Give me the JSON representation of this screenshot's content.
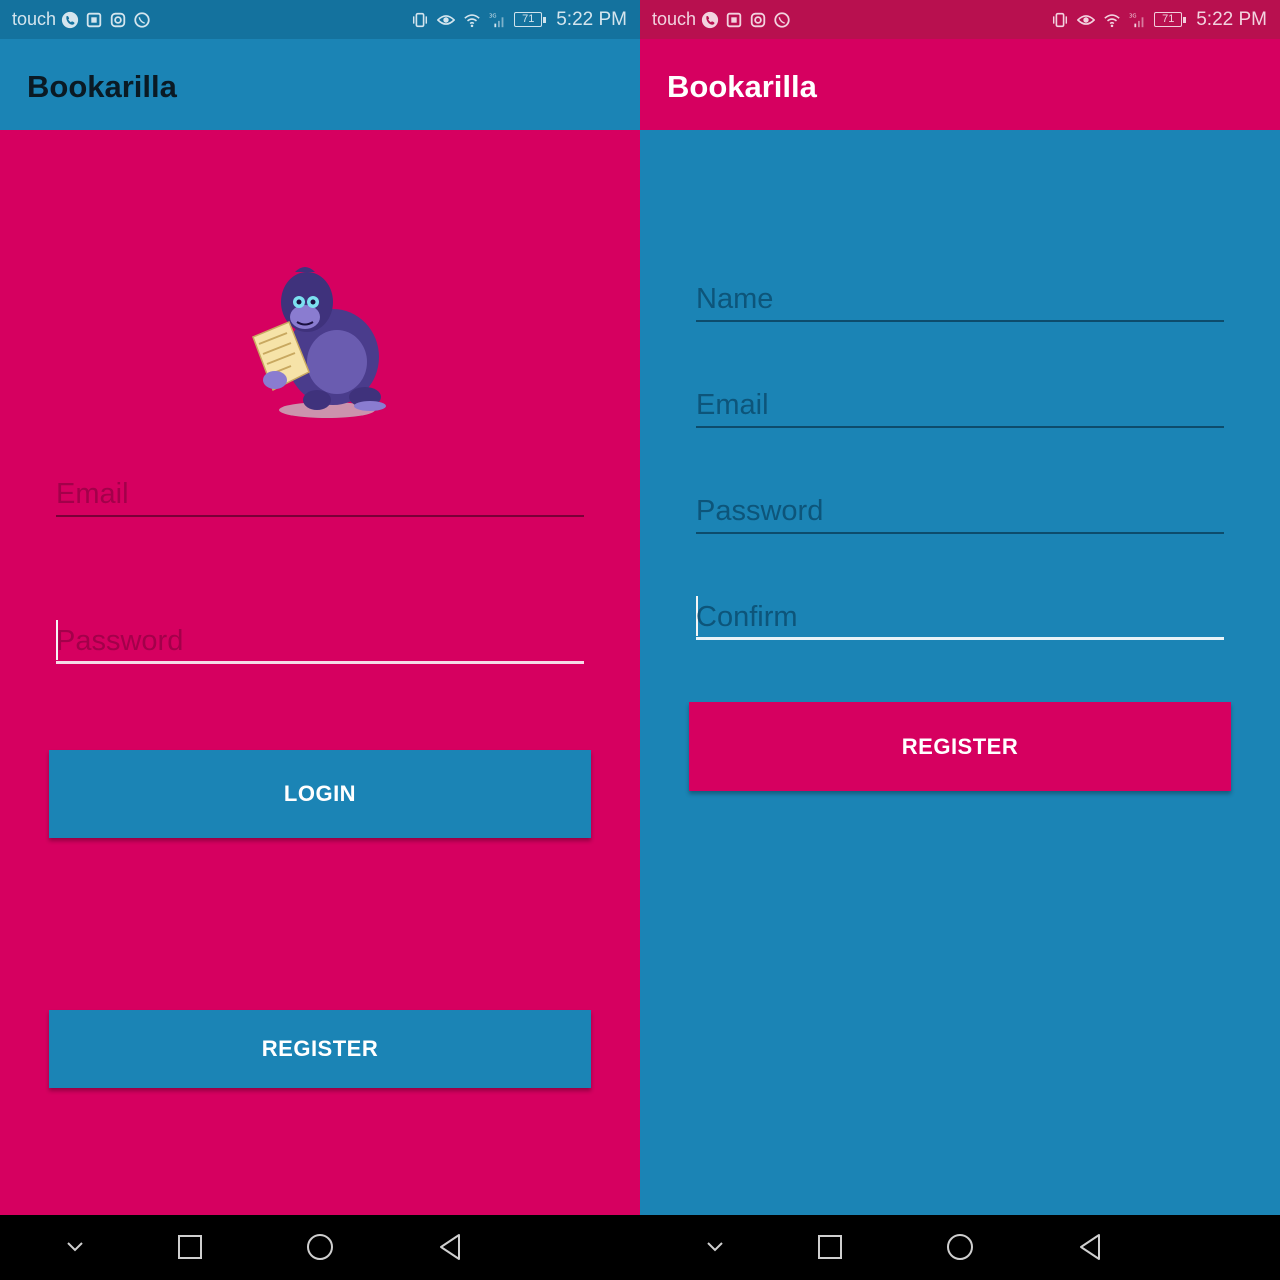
{
  "status_bar": {
    "carrier": "touch",
    "time": "5:22 PM",
    "battery": "71",
    "network": "3G"
  },
  "login_screen": {
    "app_title": "Bookarilla",
    "email_placeholder": "Email",
    "password_placeholder": "Password",
    "login_button": "LOGIN",
    "register_button": "REGISTER"
  },
  "register_screen": {
    "app_title": "Bookarilla",
    "name_placeholder": "Name",
    "email_placeholder": "Email",
    "password_placeholder": "Password",
    "confirm_placeholder": "Confirm",
    "register_button": "REGISTER"
  },
  "colors": {
    "pink": "#d60060",
    "blue": "#1b84b5",
    "pink_statusbar": "#b8104f",
    "blue_statusbar": "#14729e"
  },
  "navigation": [
    "chevron-down-icon",
    "square-icon",
    "circle-icon",
    "back-triangle-icon"
  ]
}
